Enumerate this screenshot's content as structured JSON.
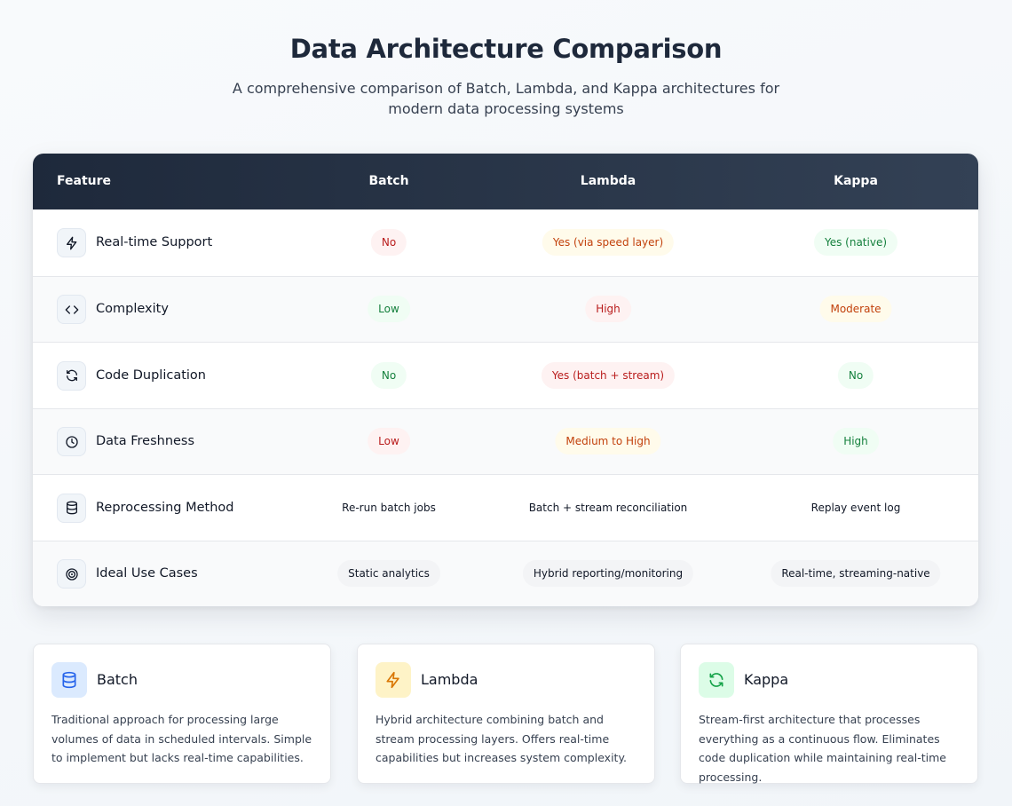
{
  "header": {
    "title": "Data Architecture Comparison",
    "subtitle": "A comprehensive comparison of Batch, Lambda, and Kappa architectures for modern data processing systems"
  },
  "table": {
    "columns": [
      "Feature",
      "Batch",
      "Lambda",
      "Kappa"
    ],
    "rows": [
      {
        "feature": "Real-time Support",
        "icon": "bolt-icon",
        "cells": [
          {
            "text": "No",
            "style": "red"
          },
          {
            "text": "Yes (via speed layer)",
            "style": "amber"
          },
          {
            "text": "Yes (native)",
            "style": "green"
          }
        ]
      },
      {
        "feature": "Complexity",
        "icon": "code-icon",
        "cells": [
          {
            "text": "Low",
            "style": "green"
          },
          {
            "text": "High",
            "style": "red"
          },
          {
            "text": "Moderate",
            "style": "amber"
          }
        ]
      },
      {
        "feature": "Code Duplication",
        "icon": "refresh-icon",
        "cells": [
          {
            "text": "No",
            "style": "green"
          },
          {
            "text": "Yes (batch + stream)",
            "style": "red"
          },
          {
            "text": "No",
            "style": "green"
          }
        ]
      },
      {
        "feature": "Data Freshness",
        "icon": "clock-icon",
        "cells": [
          {
            "text": "Low",
            "style": "red"
          },
          {
            "text": "Medium to High",
            "style": "amber"
          },
          {
            "text": "High",
            "style": "green"
          }
        ]
      },
      {
        "feature": "Reprocessing Method",
        "icon": "database-icon",
        "cells": [
          {
            "text": "Re-run batch jobs",
            "style": "plain"
          },
          {
            "text": "Batch + stream reconciliation",
            "style": "plain"
          },
          {
            "text": "Replay event log",
            "style": "plain"
          }
        ]
      },
      {
        "feature": "Ideal Use Cases",
        "icon": "target-icon",
        "cells": [
          {
            "text": "Static analytics",
            "style": "gray"
          },
          {
            "text": "Hybrid reporting/monitoring",
            "style": "gray"
          },
          {
            "text": "Real-time, streaming-native",
            "style": "gray"
          }
        ]
      }
    ]
  },
  "cards": [
    {
      "title": "Batch",
      "icon": "database-icon",
      "accent": "#2563eb",
      "tint": "#dbeafe",
      "description": "Traditional approach for processing large volumes of data in scheduled intervals. Simple to implement but lacks real-time capabilities."
    },
    {
      "title": "Lambda",
      "icon": "bolt-icon",
      "accent": "#d97706",
      "tint": "#fef3c7",
      "description": "Hybrid architecture combining batch and stream processing layers. Offers real-time capabilities but increases system complexity."
    },
    {
      "title": "Kappa",
      "icon": "refresh-icon",
      "accent": "#16a34a",
      "tint": "#dcfce7",
      "description": "Stream-first architecture that processes everything as a continuous flow. Eliminates code duplication while maintaining real-time processing."
    }
  ],
  "colors": {
    "header_dark": "#1e293b",
    "pill_red_text": "#b91c1c",
    "pill_amber_text": "#c2410c",
    "pill_green_text": "#15803d"
  }
}
